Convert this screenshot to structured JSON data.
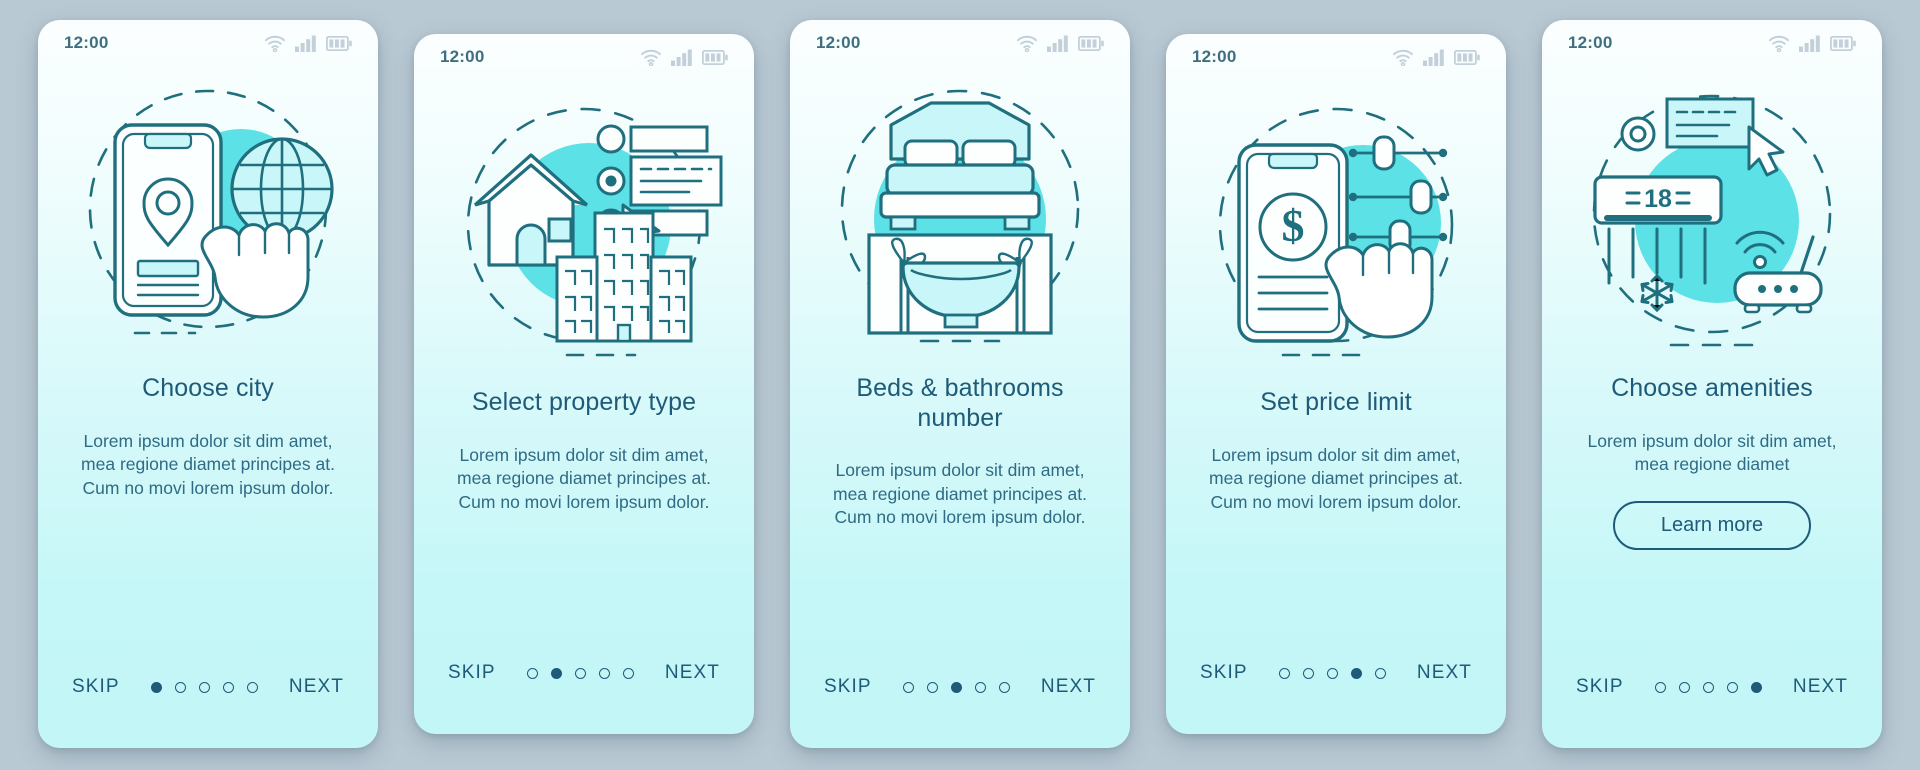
{
  "theme": {
    "page_background": "#b9c9d3",
    "card_top": "#fbfeff",
    "card_bottom": "#c2f6f7",
    "accent_blob": "#5ce1e6",
    "stroke": "#1f6f7e",
    "title_color": "#1e5b79",
    "body_color": "#2f6b84"
  },
  "status_bar": {
    "time": "12:00",
    "icons": [
      "wifi-icon",
      "cellular-signal-icon",
      "battery-icon"
    ]
  },
  "common": {
    "skip_label": "SKIP",
    "next_label": "NEXT",
    "dot_count": 5
  },
  "screens": [
    {
      "id": "choose-city",
      "title": "Choose city",
      "description": "Lorem ipsum dolor sit dim amet, mea regione diamet principes at. Cum no movi lorem ipsum dolor.",
      "illustration": "phone-location-globe-hand",
      "active_dot": 1,
      "has_learn_more": false,
      "learn_more_label": null,
      "height_variant": "tall"
    },
    {
      "id": "select-property-type",
      "title": "Select property type",
      "description": "Lorem ipsum dolor sit dim amet, mea regione diamet principes at. Cum no movi lorem ipsum dolor.",
      "illustration": "house-buildings-radio-cursor",
      "active_dot": 2,
      "has_learn_more": false,
      "learn_more_label": null,
      "height_variant": "short"
    },
    {
      "id": "beds-bathrooms-number",
      "title": "Beds & bathrooms number",
      "description": "Lorem ipsum dolor sit dim amet, mea regione diamet principes at. Cum no movi lorem ipsum dolor.",
      "illustration": "bed-bathtub-plants",
      "active_dot": 3,
      "has_learn_more": false,
      "learn_more_label": null,
      "height_variant": "tall"
    },
    {
      "id": "set-price-limit",
      "title": "Set price limit",
      "description": "Lorem ipsum dolor sit dim amet, mea regione diamet principes at. Cum no movi lorem ipsum dolor.",
      "illustration": "phone-dollar-sliders-hand",
      "active_dot": 4,
      "has_learn_more": false,
      "learn_more_label": null,
      "height_variant": "short"
    },
    {
      "id": "choose-amenities",
      "title": "Choose amenities",
      "description": "Lorem ipsum dolor sit dim amet, mea regione diamet",
      "illustration": "air-conditioner-router-snowflake",
      "active_dot": 5,
      "has_learn_more": true,
      "learn_more_label": "Learn more",
      "ac_display_value": "18",
      "height_variant": "tall"
    }
  ]
}
